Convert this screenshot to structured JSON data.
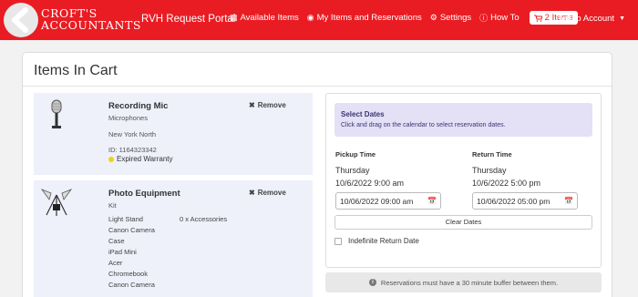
{
  "brand": {
    "logo_line1": "CROFT'S",
    "logo_line2": "ACCOUNTANTS",
    "title": "RVH Request Portal"
  },
  "nav": {
    "items": [
      {
        "label": "Available Items",
        "icon": "grid-icon"
      },
      {
        "label": "My Items and Reservations",
        "icon": "user-circle-icon"
      },
      {
        "label": "Settings",
        "icon": "gears-icon"
      },
      {
        "label": "How To",
        "icon": "question-circle-icon"
      }
    ],
    "cart_label": "2 Items",
    "account_label": "Reftab Account"
  },
  "page": {
    "title": "Items In Cart"
  },
  "cart_items": [
    {
      "name": "Recording Mic",
      "category": "Microphones",
      "location": "New York North",
      "id": "ID: 1164323342",
      "warranty": "Expired Warranty",
      "remove_label": "Remove"
    },
    {
      "name": "Photo Equipment",
      "category": "Kit",
      "accessories_count": "0 x Accessories",
      "contents": [
        "Light Stand",
        "Canon Camera",
        "Case",
        "iPad Mini",
        "Acer",
        "Chromebook",
        "Canon Camera"
      ],
      "remove_label": "Remove"
    }
  ],
  "reservation": {
    "alert_title": "Select Dates",
    "alert_text": "Click and drag on the calendar to select reservation dates.",
    "pickup_label": "Pickup Time",
    "pickup_day": "Thursday",
    "pickup_date": "10/6/2022 9:00 am",
    "pickup_input": "10/06/2022 09:00 am",
    "return_label": "Return Time",
    "return_day": "Thursday",
    "return_date": "10/6/2022 5:00 pm",
    "return_input": "10/06/2022 05:00 pm",
    "clear_label": "Clear Dates",
    "indefinite_label": "Indefinite Return Date"
  },
  "notice": "Reservations must have a 30 minute buffer between them.",
  "colors": {
    "nav_red": "#ea1c23",
    "item_bg": "#eef0fa",
    "alert_bg": "#e4e0f5",
    "warranty_dot": "#f0d30f"
  }
}
